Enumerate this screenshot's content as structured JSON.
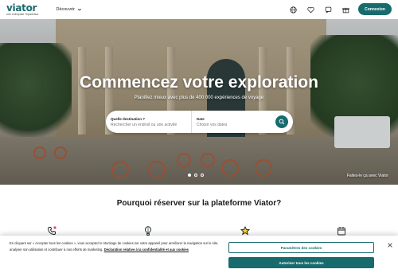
{
  "header": {
    "logo": "viator",
    "logo_tagline": "une entreprise Tripadvisor",
    "discover_label": "Découvrir",
    "icons": [
      "globe-icon",
      "heart-icon",
      "chat-icon",
      "gift-icon"
    ],
    "login_label": "Connexion"
  },
  "hero": {
    "title": "Commencez votre exploration",
    "subtitle": "Planifiez mieux avec plus de 400 000 expériences de voyage",
    "search": {
      "destination_label": "Quelle destination ?",
      "destination_placeholder": "Rechercher un endroit ou une activité",
      "date_label": "Date",
      "date_placeholder": "Choisir vos dates"
    },
    "slide_count": 3,
    "active_slide": 1,
    "credit": "Faites-le ça avec Viator"
  },
  "why": {
    "title": "Pourquoi réserver sur la plateforme Viator?",
    "icons": [
      "phone-icon",
      "balloon-icon",
      "star-icon",
      "calendar-icon"
    ]
  },
  "cookie": {
    "text": "En cliquant sur « Accepter tous les cookies », vous acceptez le stockage de cookies sur votre appareil pour améliorer la navigation sur le site, analyser son utilisation et contribuer à nos efforts de marketing.",
    "link": "Déclaration relative à la confidentialité et aux cookies",
    "settings_label": "Paramètres des cookies",
    "accept_label": "Autoriser tous les cookies"
  },
  "colors": {
    "brand": "#186b6d"
  }
}
